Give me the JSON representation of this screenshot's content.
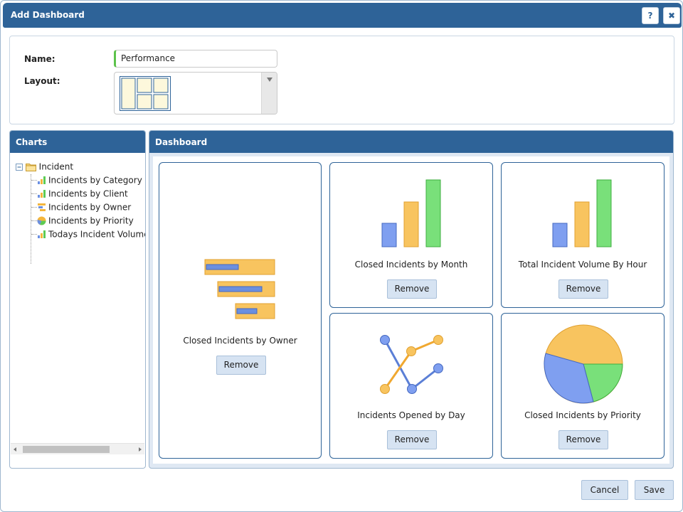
{
  "dialog": {
    "title": "Add Dashboard",
    "help_label": "?",
    "close_label": "✖"
  },
  "form": {
    "name_label": "Name:",
    "name_value": "Performance",
    "layout_label": "Layout:"
  },
  "charts_panel": {
    "title": "Charts",
    "root_label": "Incident",
    "items": [
      {
        "label": "Incidents by Category",
        "icon": "bar-chart-icon"
      },
      {
        "label": "Incidents by Client",
        "icon": "bar-chart-icon"
      },
      {
        "label": "Incidents by Owner",
        "icon": "horizontal-bar-chart-icon"
      },
      {
        "label": "Incidents by Priority",
        "icon": "pie-chart-icon"
      },
      {
        "label": "Todays Incident Volume",
        "icon": "bar-chart-icon"
      }
    ]
  },
  "dashboard_panel": {
    "title": "Dashboard",
    "cards": [
      {
        "title": "Closed Incidents by Owner",
        "remove_label": "Remove",
        "icon": "horizontal-bar-chart-icon"
      },
      {
        "title": "Closed Incidents by Month",
        "remove_label": "Remove",
        "icon": "bar-chart-icon"
      },
      {
        "title": "Total Incident Volume By Hour",
        "remove_label": "Remove",
        "icon": "bar-chart-icon"
      },
      {
        "title": "Incidents Opened by Day",
        "remove_label": "Remove",
        "icon": "line-chart-icon"
      },
      {
        "title": "Closed Incidents by Priority",
        "remove_label": "Remove",
        "icon": "pie-chart-icon"
      }
    ]
  },
  "footer": {
    "cancel_label": "Cancel",
    "save_label": "Save"
  },
  "colors": {
    "header_blue": "#2e6398",
    "button_bg": "#d6e3f2",
    "name_accent": "#5cc24a"
  }
}
